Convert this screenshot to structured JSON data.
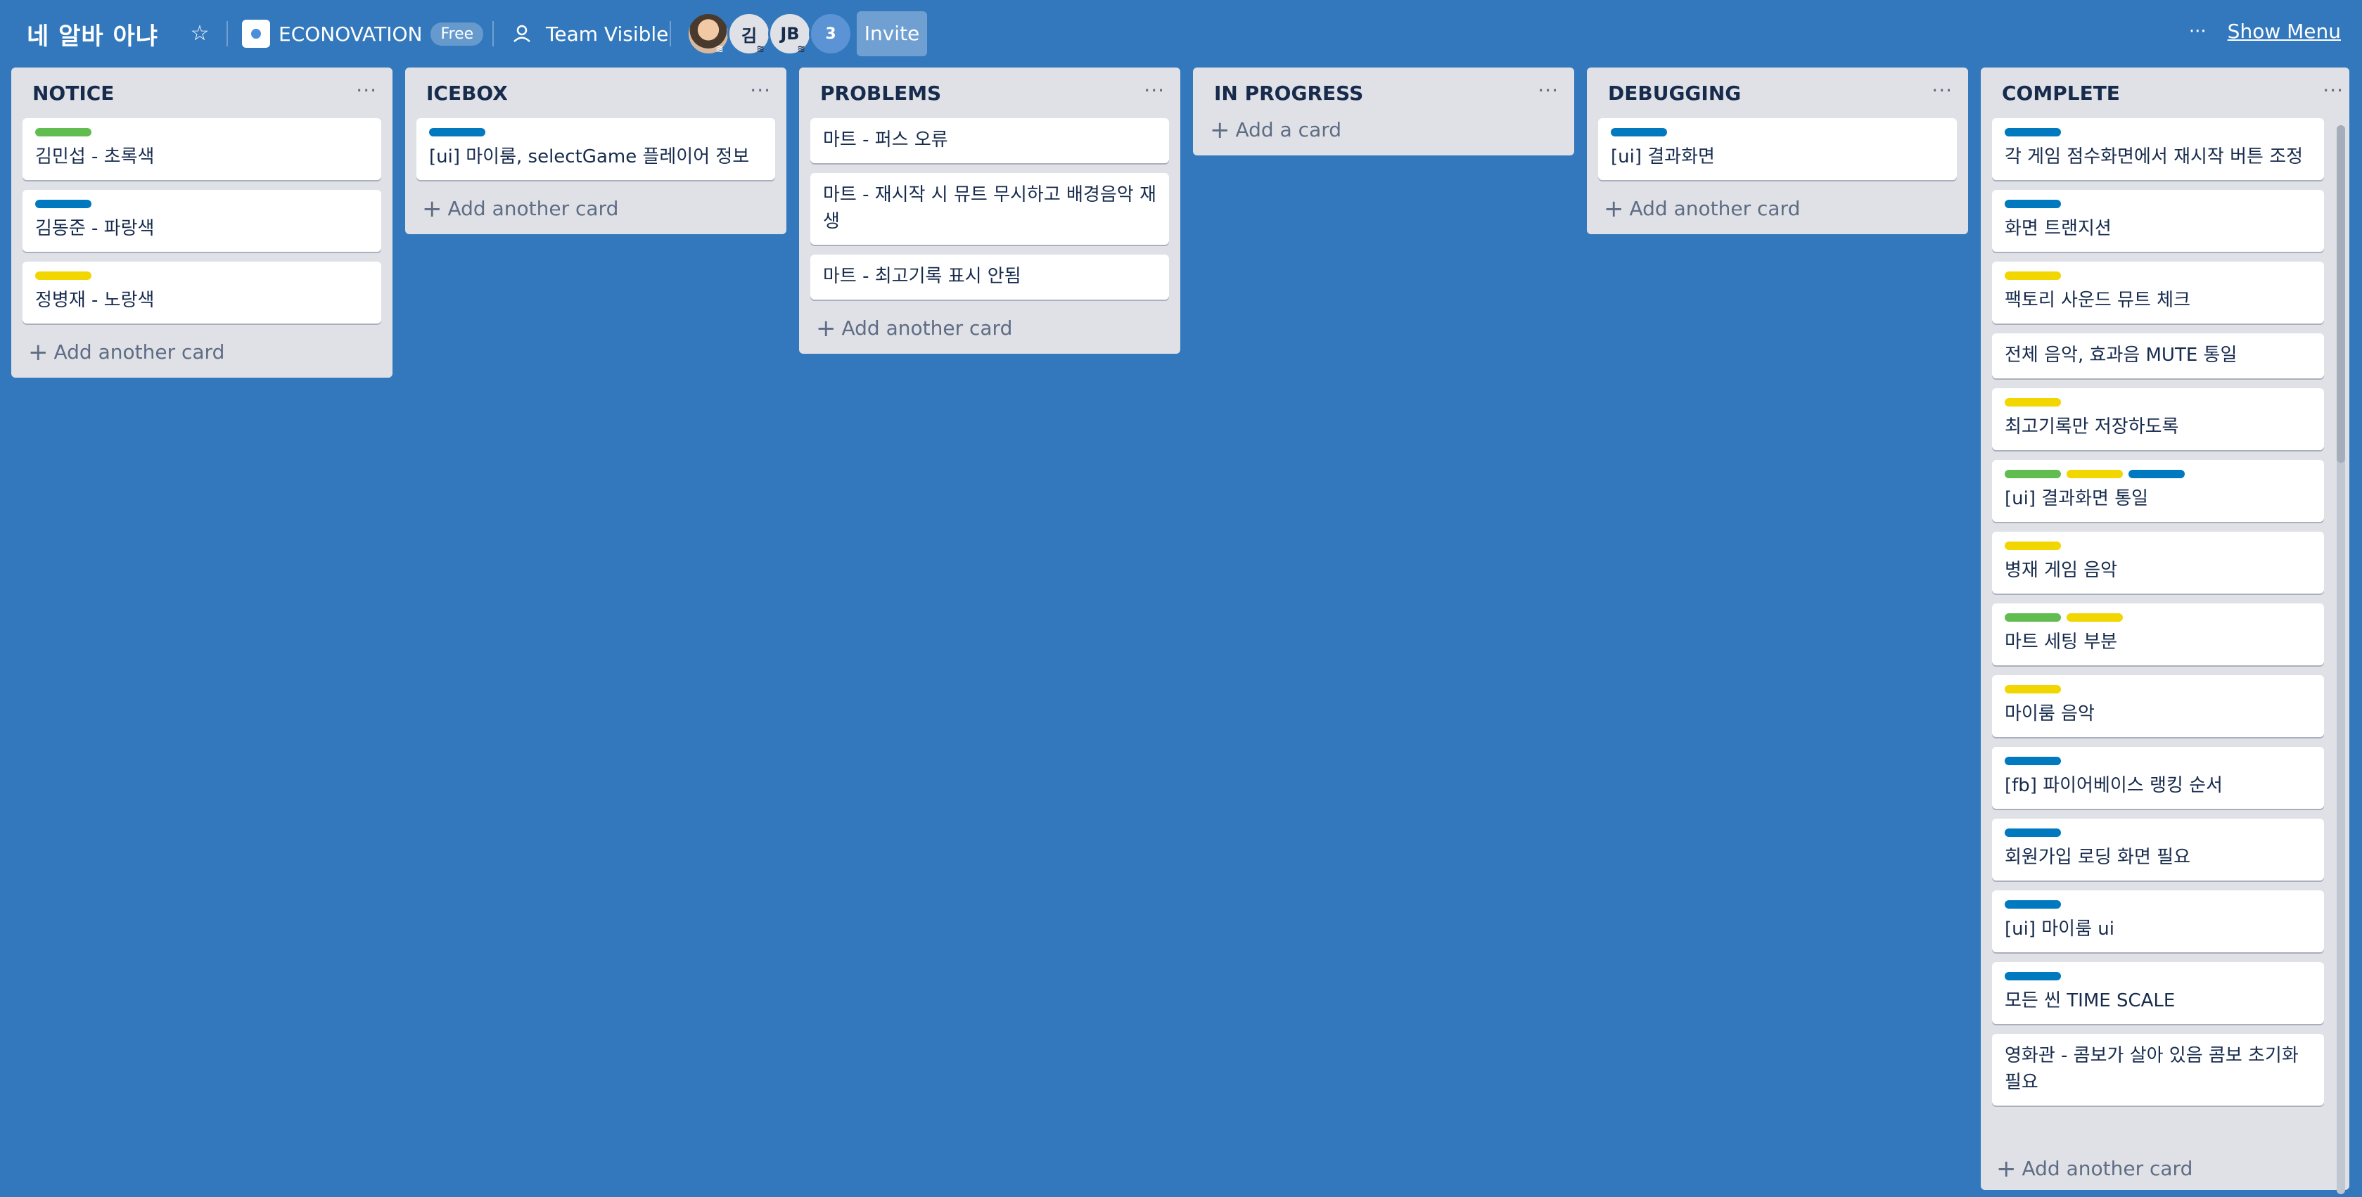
{
  "board": {
    "title": "네 알바 아냐",
    "team_name": "ECONOVATION",
    "team_plan": "Free",
    "visibility": "Team Visible",
    "members": [
      "김",
      "JB"
    ],
    "member_extra_count": "3",
    "invite_label": "Invite",
    "show_menu_label": "Show Menu",
    "menu_dots": "···"
  },
  "colors": {
    "background": "#3378bd",
    "green": "#61bd4f",
    "blue": "#0079bf",
    "yellow": "#f2d600"
  },
  "lists": [
    {
      "title": "NOTICE",
      "add_label": "Add another card",
      "cards": [
        {
          "title": "김민섭 - 초록색",
          "labels": [
            "green"
          ]
        },
        {
          "title": "김동준 - 파랑색",
          "labels": [
            "blue"
          ]
        },
        {
          "title": "정병재 - 노랑색",
          "labels": [
            "yellow"
          ]
        }
      ]
    },
    {
      "title": "ICEBOX",
      "add_label": "Add another card",
      "cards": [
        {
          "title": "[ui] 마이룸, selectGame 플레이어 정보",
          "labels": [
            "blue"
          ]
        }
      ]
    },
    {
      "title": "PROBLEMS",
      "add_label": "Add another card",
      "cards": [
        {
          "title": "마트 - 퍼스 오류",
          "labels": []
        },
        {
          "title": "마트 - 재시작 시 뮤트 무시하고 배경음악 재생",
          "labels": []
        },
        {
          "title": "마트 - 최고기록 표시 안됨",
          "labels": []
        }
      ]
    },
    {
      "title": "IN PROGRESS",
      "add_label": "Add a card",
      "cards": []
    },
    {
      "title": "DEBUGGING",
      "add_label": "Add another card",
      "cards": [
        {
          "title": "[ui] 결과화면",
          "labels": [
            "blue"
          ]
        }
      ]
    },
    {
      "title": "COMPLETE",
      "add_label": "Add another card",
      "cards": [
        {
          "title": "각 게임 점수화면에서 재시작 버튼 조정",
          "labels": [
            "blue"
          ]
        },
        {
          "title": "화면 트랜지션",
          "labels": [
            "blue"
          ]
        },
        {
          "title": "팩토리 사운드 뮤트 체크",
          "labels": [
            "yellow"
          ]
        },
        {
          "title": "전체 음악, 효과음 MUTE 통일",
          "labels": []
        },
        {
          "title": "최고기록만 저장하도록",
          "labels": [
            "yellow"
          ]
        },
        {
          "title": "[ui] 결과화면 통일",
          "labels": [
            "green",
            "yellow",
            "blue"
          ]
        },
        {
          "title": "병재 게임 음악",
          "labels": [
            "yellow"
          ]
        },
        {
          "title": "마트 세팅 부분",
          "labels": [
            "green",
            "yellow"
          ]
        },
        {
          "title": "마이룸 음악",
          "labels": [
            "yellow"
          ]
        },
        {
          "title": "[fb] 파이어베이스 랭킹 순서",
          "labels": [
            "blue"
          ]
        },
        {
          "title": "회원가입 로딩 화면 필요",
          "labels": [
            "blue"
          ]
        },
        {
          "title": "[ui] 마이룸 ui",
          "labels": [
            "blue"
          ]
        },
        {
          "title": "모든 씬 TIME SCALE",
          "labels": [
            "blue"
          ]
        },
        {
          "title": "영화관 - 콤보가 살아 있음 콤보 초기화 필요",
          "labels": []
        }
      ]
    }
  ]
}
